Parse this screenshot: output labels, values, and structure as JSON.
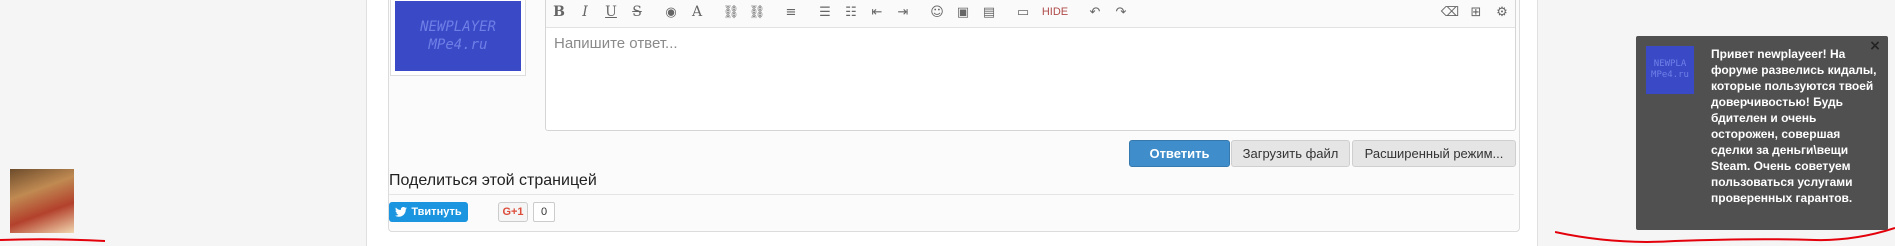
{
  "reply": {
    "avatar_lines": [
      "NEWPLAYER",
      "MPe4.ru"
    ],
    "placeholder": "Напишите ответ...",
    "toolbar": {
      "bold": "B",
      "italic": "I",
      "underline": "U",
      "strike": "S",
      "font_color": "◉",
      "font_name": "A",
      "link": "⛓",
      "unlink": "⛓",
      "align": "≡",
      "ul": "☰",
      "ol": "☷",
      "outdent": "⇤",
      "indent": "⇥",
      "smilies": "☺",
      "image": "▣",
      "media": "▤",
      "draft": "▭",
      "hide": "HIDE",
      "undo": "↶",
      "redo": "↷",
      "remove_format": "⌫",
      "insert": "⊞",
      "settings": "⚙"
    },
    "submit_label": "Ответить",
    "upload_label": "Загрузить файл",
    "advanced_label": "Расширенный режим..."
  },
  "share": {
    "title": "Поделиться этой страницей",
    "tweet_label": "Твитнуть",
    "gplus_label": "G+1",
    "gplus_count": "0"
  },
  "notice": {
    "avatar_lines": [
      "NEWPLA",
      "MPe4.ru"
    ],
    "close": "×",
    "text": "Привет newplayeer! На форуме развелись кидалы, которые пользуются твоей доверчивостью! Будь бдителен и очень осторожен, совершая сделки за деньги\\вещи Steam. Очень советуем пользоваться услугами проверенных гарантов."
  },
  "colors": {
    "primary": "#3f8ecb",
    "tweet": "#1b95e0",
    "notice_bg": "#505050",
    "avatar_bg": "#3a4ac7",
    "annotation": "#e3000b"
  }
}
